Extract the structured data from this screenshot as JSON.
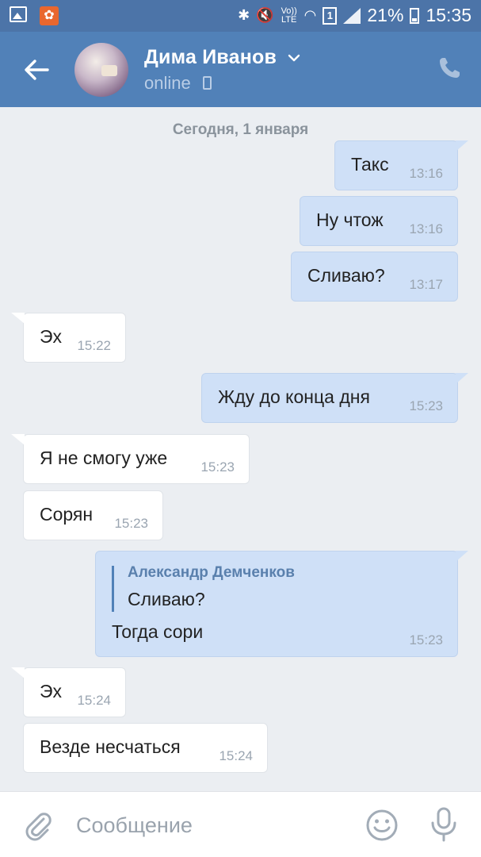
{
  "status_bar": {
    "battery_percent": "21%",
    "time": "15:35",
    "sim_slot": "1",
    "network_label": "Vo)) LTE"
  },
  "header": {
    "contact_name": "Дима Иванов",
    "status": "online"
  },
  "chat": {
    "date_separator": "Сегодня, 1 января",
    "messages": [
      {
        "dir": "out",
        "text": "Такс",
        "time": "13:16"
      },
      {
        "dir": "out",
        "text": "Ну чтож",
        "time": "13:16"
      },
      {
        "dir": "out",
        "text": "Сливаю?",
        "time": "13:17"
      },
      {
        "dir": "in",
        "text": "Эх",
        "time": "15:22"
      },
      {
        "dir": "out",
        "text": "Жду до конца дня",
        "time": "15:23"
      },
      {
        "dir": "in",
        "text": "Я не смогу уже",
        "time": "15:23"
      },
      {
        "dir": "in",
        "text": "Сорян",
        "time": "15:23"
      },
      {
        "dir": "out",
        "reply_author": "Александр Демченков",
        "reply_text": "Сливаю?",
        "text": "Тогда сори",
        "time": "15:23"
      },
      {
        "dir": "in",
        "text": "Эх",
        "time": "15:24"
      },
      {
        "dir": "in",
        "text": "Везде несчаться",
        "time": "15:24"
      }
    ]
  },
  "composer": {
    "placeholder": "Сообщение"
  },
  "colors": {
    "header_bg": "#5181b8",
    "status_bar_bg": "#4c74a8",
    "outgoing_bubble": "#cfe0f7",
    "incoming_bubble": "#ffffff",
    "chat_bg": "#ebeef2"
  }
}
